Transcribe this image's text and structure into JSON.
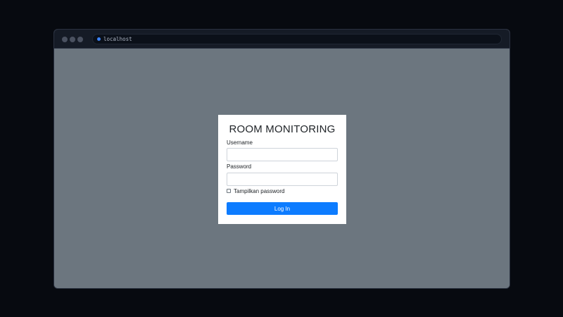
{
  "browser": {
    "address": "localhost"
  },
  "login": {
    "title": "ROOM MONITORING",
    "username_label": "Username",
    "username_value": "",
    "password_label": "Password",
    "password_value": "",
    "show_password_label": "Tampilkan password",
    "show_password_checked": false,
    "submit_label": "Log In"
  },
  "colors": {
    "page_background": "#6c767f",
    "primary_button": "#0d7cff",
    "card_background": "#ffffff"
  }
}
